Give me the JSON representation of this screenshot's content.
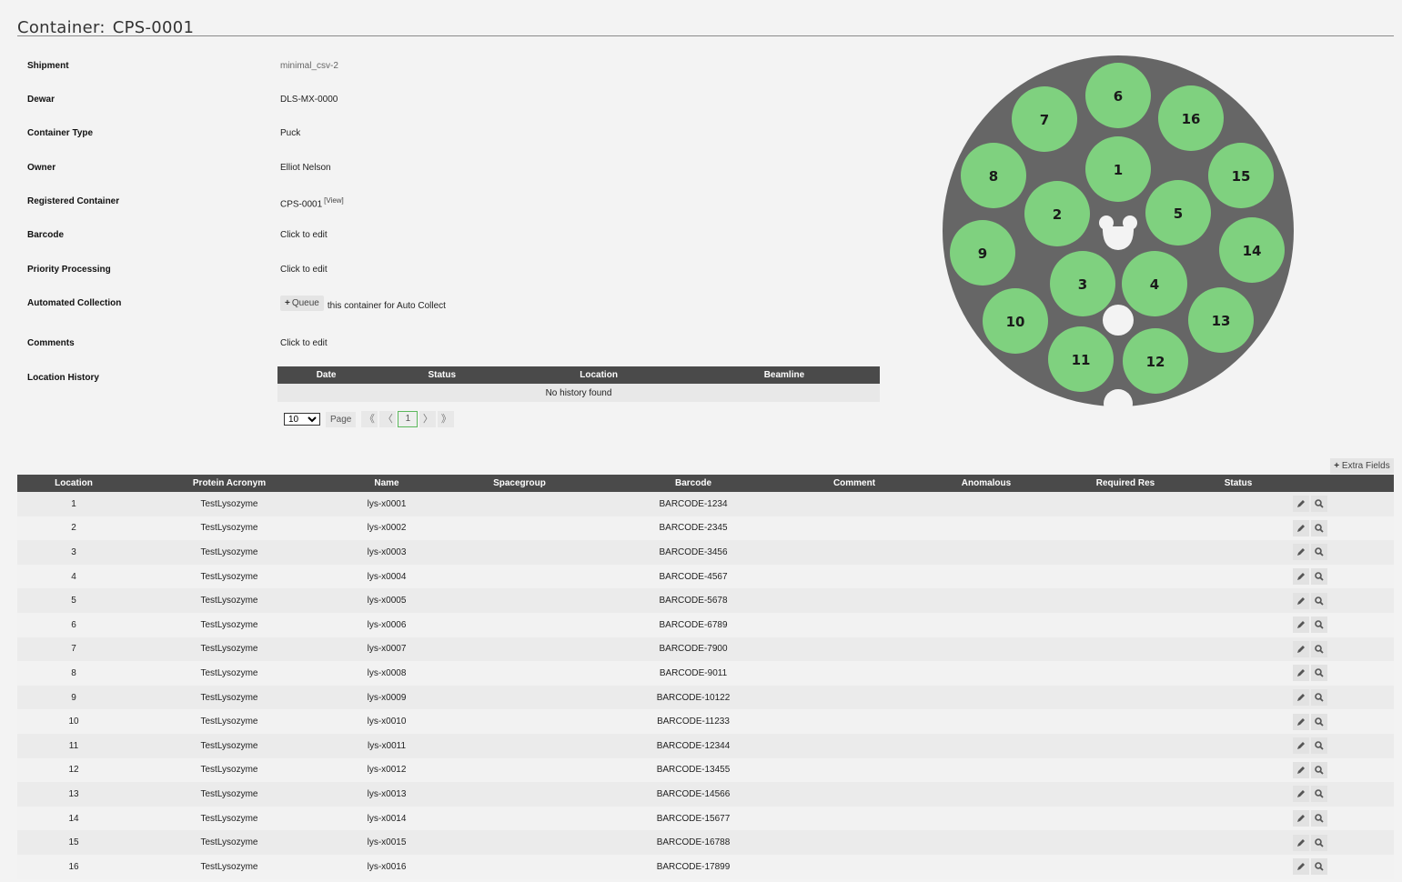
{
  "header": {
    "prefix": "Container:",
    "name": "CPS-0001"
  },
  "details": {
    "shipment": {
      "label": "Shipment",
      "value": "minimal_csv-2"
    },
    "dewar": {
      "label": "Dewar",
      "value": "DLS-MX-0000"
    },
    "container_type": {
      "label": "Container Type",
      "value": "Puck"
    },
    "owner": {
      "label": "Owner",
      "value": "Elliot Nelson"
    },
    "registered_container": {
      "label": "Registered Container",
      "value": "CPS-0001",
      "link": "[View]"
    },
    "barcode": {
      "label": "Barcode",
      "value": "Click to edit"
    },
    "priority_processing": {
      "label": "Priority Processing",
      "value": "Click to edit"
    },
    "automated_collection": {
      "label": "Automated Collection",
      "button": "Queue",
      "text": "this container for Auto Collect"
    },
    "comments": {
      "label": "Comments",
      "value": "Click to edit"
    },
    "location_history": {
      "label": "Location History"
    }
  },
  "history": {
    "columns": [
      "Date",
      "Status",
      "Location",
      "Beamline"
    ],
    "empty_text": "No history found",
    "pager": {
      "page_size": "10",
      "page_label": "Page",
      "current_page": "1",
      "first": "《",
      "prev": "〈",
      "next": "〉",
      "last": "》"
    }
  },
  "puck": {
    "positions": [
      "1",
      "2",
      "3",
      "4",
      "5",
      "6",
      "7",
      "8",
      "9",
      "10",
      "11",
      "12",
      "13",
      "14",
      "15",
      "16"
    ],
    "filled_color": "#7fd17f",
    "body_color": "#666666"
  },
  "samples": {
    "extra_fields_label": "Extra Fields",
    "columns": [
      "Location",
      "Protein Acronym",
      "Name",
      "Spacegroup",
      "Barcode",
      "Comment",
      "Anomalous",
      "Required Res",
      "Status",
      ""
    ],
    "rows": [
      {
        "location": "1",
        "protein": "TestLysozyme",
        "name": "lys-x0001",
        "spacegroup": "",
        "barcode": "BARCODE-1234",
        "comment": "",
        "anomalous": "",
        "required_res": "",
        "status": ""
      },
      {
        "location": "2",
        "protein": "TestLysozyme",
        "name": "lys-x0002",
        "spacegroup": "",
        "barcode": "BARCODE-2345",
        "comment": "",
        "anomalous": "",
        "required_res": "",
        "status": ""
      },
      {
        "location": "3",
        "protein": "TestLysozyme",
        "name": "lys-x0003",
        "spacegroup": "",
        "barcode": "BARCODE-3456",
        "comment": "",
        "anomalous": "",
        "required_res": "",
        "status": ""
      },
      {
        "location": "4",
        "protein": "TestLysozyme",
        "name": "lys-x0004",
        "spacegroup": "",
        "barcode": "BARCODE-4567",
        "comment": "",
        "anomalous": "",
        "required_res": "",
        "status": ""
      },
      {
        "location": "5",
        "protein": "TestLysozyme",
        "name": "lys-x0005",
        "spacegroup": "",
        "barcode": "BARCODE-5678",
        "comment": "",
        "anomalous": "",
        "required_res": "",
        "status": ""
      },
      {
        "location": "6",
        "protein": "TestLysozyme",
        "name": "lys-x0006",
        "spacegroup": "",
        "barcode": "BARCODE-6789",
        "comment": "",
        "anomalous": "",
        "required_res": "",
        "status": ""
      },
      {
        "location": "7",
        "protein": "TestLysozyme",
        "name": "lys-x0007",
        "spacegroup": "",
        "barcode": "BARCODE-7900",
        "comment": "",
        "anomalous": "",
        "required_res": "",
        "status": ""
      },
      {
        "location": "8",
        "protein": "TestLysozyme",
        "name": "lys-x0008",
        "spacegroup": "",
        "barcode": "BARCODE-9011",
        "comment": "",
        "anomalous": "",
        "required_res": "",
        "status": ""
      },
      {
        "location": "9",
        "protein": "TestLysozyme",
        "name": "lys-x0009",
        "spacegroup": "",
        "barcode": "BARCODE-10122",
        "comment": "",
        "anomalous": "",
        "required_res": "",
        "status": ""
      },
      {
        "location": "10",
        "protein": "TestLysozyme",
        "name": "lys-x0010",
        "spacegroup": "",
        "barcode": "BARCODE-11233",
        "comment": "",
        "anomalous": "",
        "required_res": "",
        "status": ""
      },
      {
        "location": "11",
        "protein": "TestLysozyme",
        "name": "lys-x0011",
        "spacegroup": "",
        "barcode": "BARCODE-12344",
        "comment": "",
        "anomalous": "",
        "required_res": "",
        "status": ""
      },
      {
        "location": "12",
        "protein": "TestLysozyme",
        "name": "lys-x0012",
        "spacegroup": "",
        "barcode": "BARCODE-13455",
        "comment": "",
        "anomalous": "",
        "required_res": "",
        "status": ""
      },
      {
        "location": "13",
        "protein": "TestLysozyme",
        "name": "lys-x0013",
        "spacegroup": "",
        "barcode": "BARCODE-14566",
        "comment": "",
        "anomalous": "",
        "required_res": "",
        "status": ""
      },
      {
        "location": "14",
        "protein": "TestLysozyme",
        "name": "lys-x0014",
        "spacegroup": "",
        "barcode": "BARCODE-15677",
        "comment": "",
        "anomalous": "",
        "required_res": "",
        "status": ""
      },
      {
        "location": "15",
        "protein": "TestLysozyme",
        "name": "lys-x0015",
        "spacegroup": "",
        "barcode": "BARCODE-16788",
        "comment": "",
        "anomalous": "",
        "required_res": "",
        "status": ""
      },
      {
        "location": "16",
        "protein": "TestLysozyme",
        "name": "lys-x0016",
        "spacegroup": "",
        "barcode": "BARCODE-17899",
        "comment": "",
        "anomalous": "",
        "required_res": "",
        "status": ""
      }
    ],
    "row_actions": [
      "edit-icon",
      "view-icon"
    ]
  }
}
